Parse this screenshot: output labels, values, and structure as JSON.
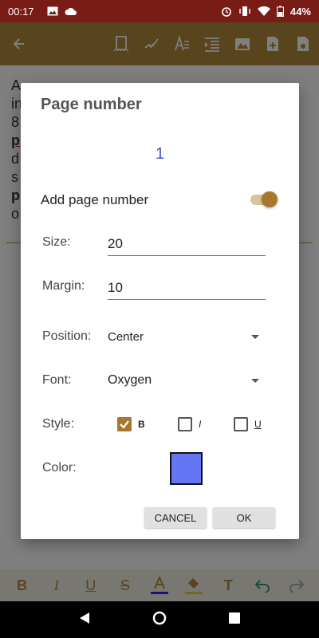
{
  "status": {
    "time": "00:17",
    "battery": "44%"
  },
  "toolbar": {
    "icons": [
      "back-arrow-icon",
      "page-setup-icon",
      "signature-icon",
      "text-style-icon",
      "indent-icon",
      "image-icon",
      "new-document-icon",
      "save-document-icon"
    ]
  },
  "document": {
    "lines": [
      "A",
      "in",
      "8",
      "p",
      "d",
      "s",
      "p",
      "o"
    ]
  },
  "dialog": {
    "title": "Page number",
    "preview_number": "1",
    "preview_color": "#3f51d5",
    "add_page_number_label": "Add page number",
    "add_page_number_enabled": true,
    "size": {
      "label": "Size:",
      "value": "20"
    },
    "margin": {
      "label": "Margin:",
      "value": "10"
    },
    "position": {
      "label": "Position:",
      "value": "Center"
    },
    "font": {
      "label": "Font:",
      "value": "Oxygen"
    },
    "style": {
      "label": "Style:",
      "bold": {
        "label": "B",
        "checked": true
      },
      "italic": {
        "label": "I",
        "checked": false
      },
      "underline": {
        "label": "U",
        "checked": false
      }
    },
    "color": {
      "label": "Color:",
      "value": "#6675f2"
    },
    "cancel_label": "CANCEL",
    "ok_label": "OK"
  },
  "format_bar": {
    "items": [
      "bold-icon",
      "italic-icon",
      "underline-icon",
      "strikethrough-icon",
      "text-color-icon",
      "fill-color-icon",
      "text-size-icon",
      "undo-icon",
      "redo-icon"
    ]
  },
  "nav": {
    "buttons": [
      "back-nav",
      "home-nav",
      "recents-nav"
    ]
  }
}
